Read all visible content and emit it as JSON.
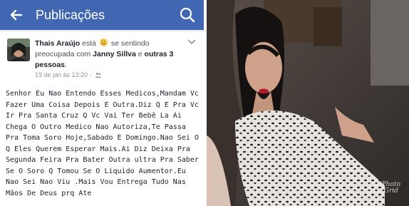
{
  "topbar": {
    "title": "Publicações",
    "back_icon": "arrow-left-icon",
    "search_icon": "search-icon",
    "background": "#4267b2"
  },
  "post": {
    "author": "Thais Araújo",
    "action_prefix": "está",
    "feeling": "se sentindo preocupada com",
    "feeling_emoji": "slightly-worried-face-icon",
    "tagged_person": "Janny Sillva",
    "connector": "e",
    "others": "outras 3 pessoas",
    "period": ".",
    "timestamp": "19 de jan às 13:20",
    "separator": "·",
    "audience_icon": "friends-icon",
    "options_icon": "chevron-down-icon",
    "body": "Senhor Eu Nao Entendo Esses Medicos,Mandam Vc Fazer Uma Coisa Depois E Outra.Diz Q E Pra Vc Ir Pra Santa Cruz Q Vc Vai Ter Bebê La Ai Chega O Outro Medico Nao Autoriza,Te Passa Pra Toma Soro Hoje,Sabado E Domingo.Nao Sei O Q Eles Querem Esperar Mais.Ai Diz Deixa Pra Segunda Feira Pra Bater Outra ultra Pra Saber Se O Soro Q Tomou Se O Liquido Aumentor.Eu Nao Sei Nao Viu .Mais Vou Entrega Tudo Nas Mãos De Deus prq Ate"
  },
  "photo": {
    "watermark_line1": "Photo",
    "watermark_line2": "Grid"
  }
}
